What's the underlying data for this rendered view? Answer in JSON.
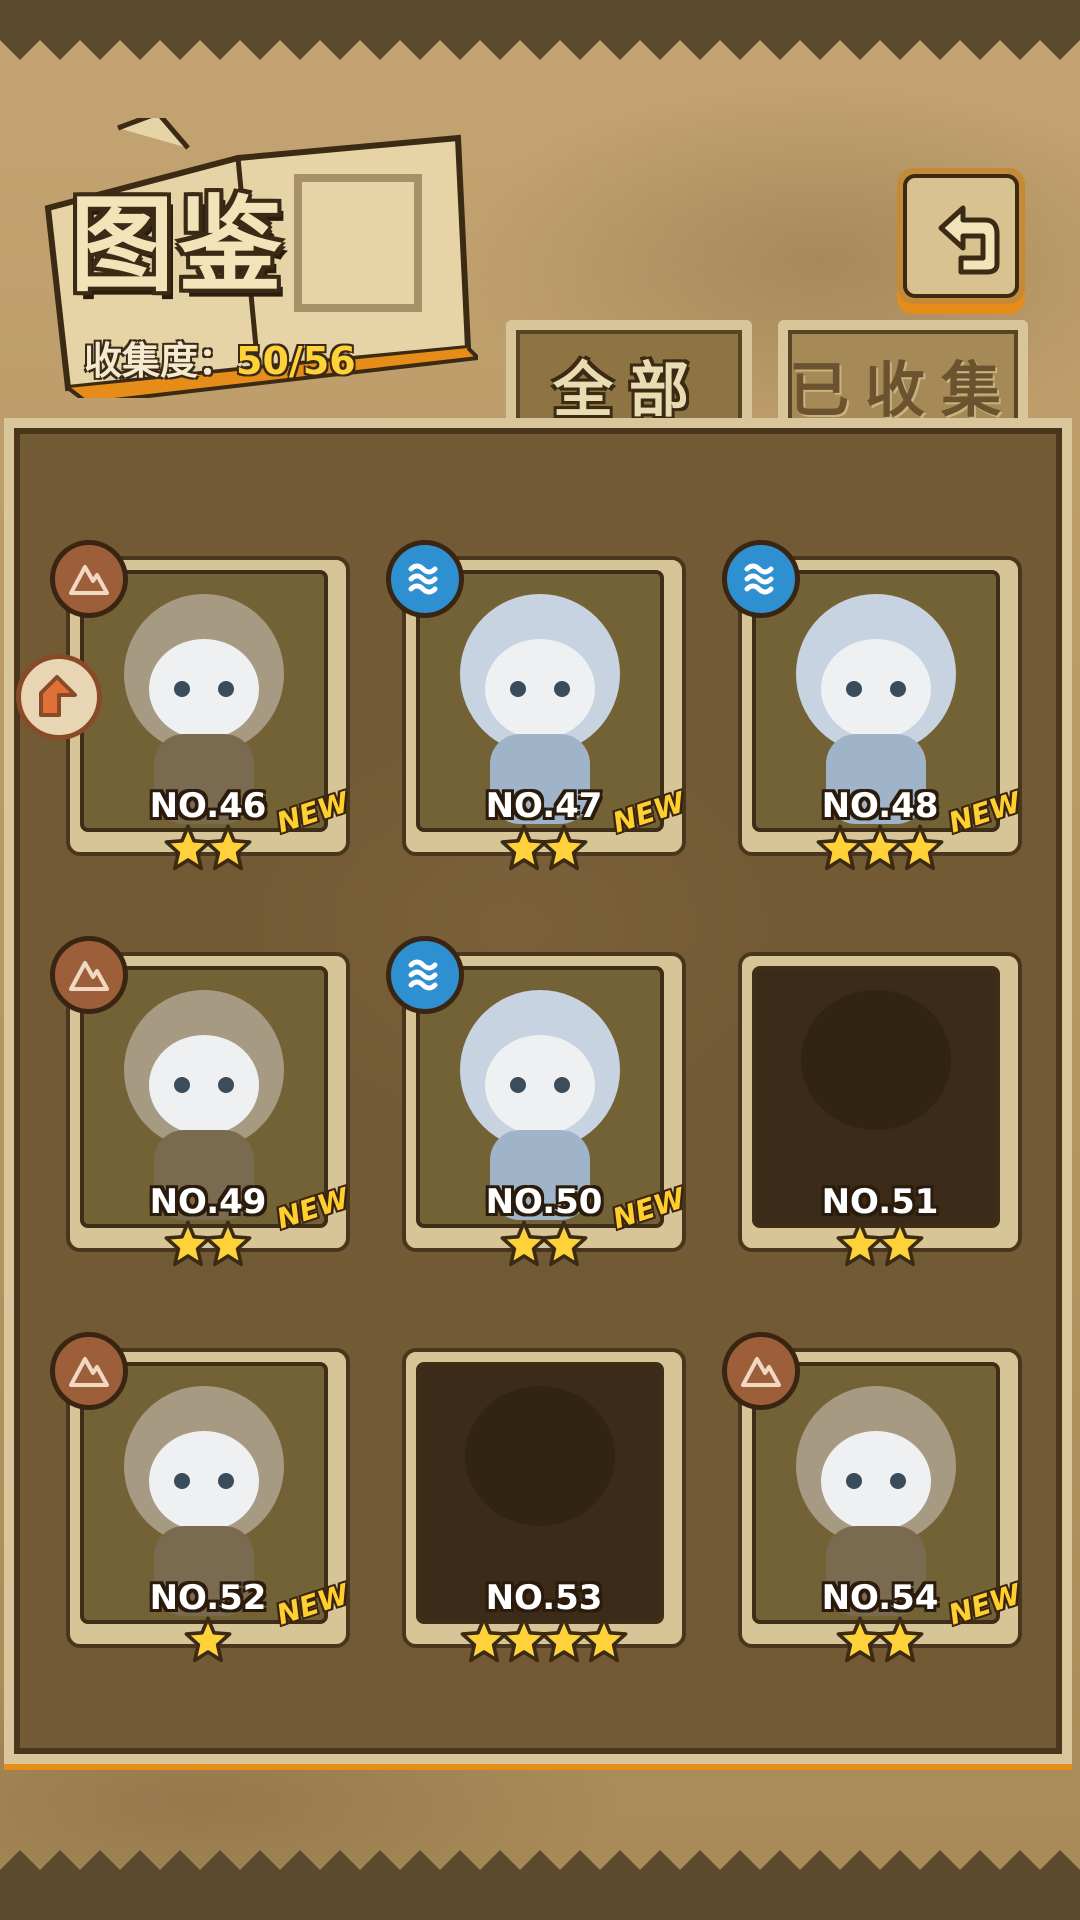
{
  "header": {
    "title": "图鉴",
    "collection_label": "收集度：",
    "collection_value": "50/56"
  },
  "tabs": [
    {
      "label": "全部",
      "active": true
    },
    {
      "label": "已收集",
      "active": false
    }
  ],
  "cards": [
    {
      "number": "NO.46",
      "stars": 2,
      "element": "earth",
      "new_badge": "NEW"
    },
    {
      "number": "NO.47",
      "stars": 2,
      "element": "water",
      "new_badge": "NEW"
    },
    {
      "number": "NO.48",
      "stars": 3,
      "element": "water",
      "new_badge": "NEW"
    },
    {
      "number": "NO.49",
      "stars": 2,
      "element": "earth",
      "new_badge": "NEW"
    },
    {
      "number": "NO.50",
      "stars": 2,
      "element": "water",
      "new_badge": "NEW"
    },
    {
      "number": "NO.51",
      "stars": 2,
      "element": "",
      "new_badge": ""
    },
    {
      "number": "NO.52",
      "stars": 1,
      "element": "earth",
      "new_badge": "NEW"
    },
    {
      "number": "NO.53",
      "stars": 4,
      "element": "",
      "new_badge": ""
    },
    {
      "number": "NO.54",
      "stars": 2,
      "element": "earth",
      "new_badge": "NEW"
    }
  ],
  "icons": {
    "back": "back-arrow-icon",
    "earth": "earth-element-icon",
    "water": "water-element-icon",
    "star": "star-icon",
    "side": "side-arrow-icon"
  },
  "colors": {
    "accent_orange": "#e58d18",
    "star_yellow": "#ffd23a",
    "collection_value": "#ffd23a",
    "water": "#2e8fd1",
    "earth": "#9c5f3a"
  }
}
